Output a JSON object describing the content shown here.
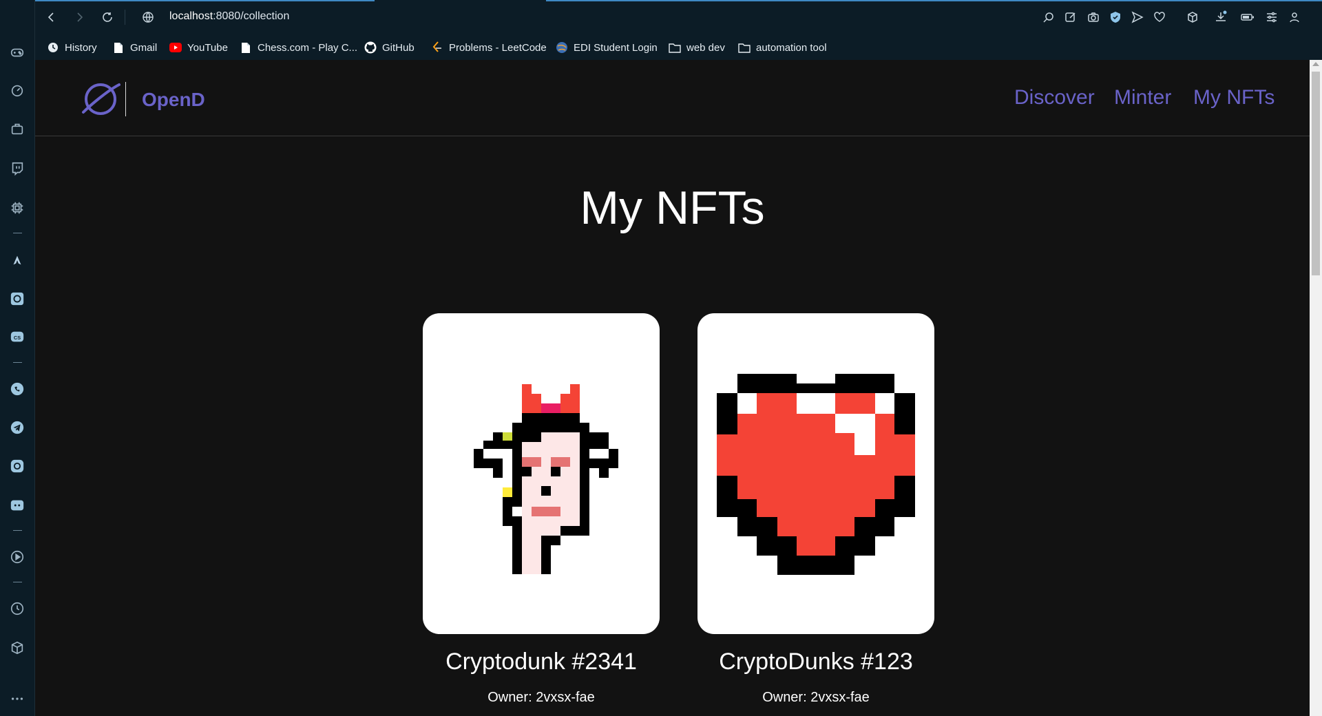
{
  "browser": {
    "url_host": "localhost",
    "url_rest": ":8080/collection",
    "bookmarks": [
      {
        "label": "History",
        "icon": "clock-icon"
      },
      {
        "label": "Gmail",
        "icon": "page-icon"
      },
      {
        "label": "YouTube",
        "icon": "youtube-icon"
      },
      {
        "label": "Chess.com - Play C...",
        "icon": "page-icon"
      },
      {
        "label": "GitHub",
        "icon": "github-icon"
      },
      {
        "label": "Problems - LeetCode",
        "icon": "leetcode-icon"
      },
      {
        "label": "EDI Student Login",
        "icon": "globe-icon"
      },
      {
        "label": "web dev",
        "icon": "folder-icon"
      },
      {
        "label": "automation tool",
        "icon": "folder-icon"
      }
    ]
  },
  "site": {
    "brand": "OpenD",
    "nav": [
      "Discover",
      "Minter",
      "My NFTs"
    ]
  },
  "main": {
    "title": "My NFTs",
    "cards": [
      {
        "name": "Cryptodunk #2341",
        "owner": "Owner: 2vxsx-fae"
      },
      {
        "name": "CryptoDunks #123",
        "owner": "Owner: 2vxsx-fae"
      }
    ]
  },
  "colors": {
    "accent": "#6a63c9",
    "browser_chrome": "#0c1c26",
    "page_bg": "#121212",
    "heart_red": "#f44336"
  }
}
